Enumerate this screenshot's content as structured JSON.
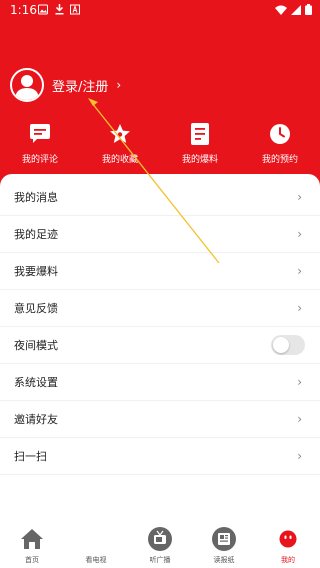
{
  "status_bar": {
    "time": "1:16"
  },
  "colors": {
    "brand_red": "#e8141c",
    "white": "#ffffff",
    "toggle_off": "#e6e6e6",
    "annotation_arrow": "#f2c230"
  },
  "login": {
    "label": "登录/注册",
    "icon": "user-avatar-icon",
    "chevron": "›"
  },
  "quick_actions": [
    {
      "label": "我的评论",
      "icon": "comment-icon"
    },
    {
      "label": "我的收藏",
      "icon": "star-icon"
    },
    {
      "label": "我的爆料",
      "icon": "document-icon"
    },
    {
      "label": "我的预约",
      "icon": "clock-icon"
    }
  ],
  "menu": [
    {
      "label": "我的消息",
      "control": "chevron",
      "chevron": "›"
    },
    {
      "label": "我的足迹",
      "control": "chevron",
      "chevron": "›"
    },
    {
      "label": "我要爆料",
      "control": "chevron",
      "chevron": "›"
    },
    {
      "label": "意见反馈",
      "control": "chevron",
      "chevron": "›"
    },
    {
      "label": "夜间模式",
      "control": "toggle",
      "toggle_on": false
    },
    {
      "label": "系统设置",
      "control": "chevron",
      "chevron": "›"
    },
    {
      "label": "邀请好友",
      "control": "chevron",
      "chevron": "›"
    },
    {
      "label": "扫一扫",
      "control": "chevron",
      "chevron": "›"
    }
  ],
  "tabs": [
    {
      "label": "首页",
      "icon": "home-icon",
      "active": false
    },
    {
      "label": "看电视",
      "icon": "tv-icon",
      "active": false
    },
    {
      "label": "听广播",
      "icon": "radio-icon",
      "active": false
    },
    {
      "label": "读报纸",
      "icon": "newspaper-icon",
      "active": false
    },
    {
      "label": "我的",
      "icon": "profile-icon",
      "active": true
    }
  ]
}
